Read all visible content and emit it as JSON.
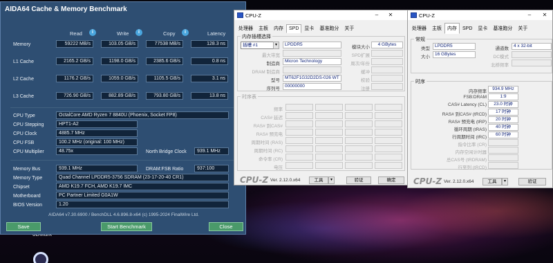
{
  "desktop": {
    "icon_label": "3DMark"
  },
  "aida": {
    "title": "AIDA64 Cache & Memory Benchmark",
    "col_read": "Read",
    "col_write": "Write",
    "col_copy": "Copy",
    "col_latency": "Latency",
    "rows": [
      {
        "label": "Memory",
        "read": "59222 MB/s",
        "write": "103.05 GB/s",
        "copy": "77538 MB/s",
        "latency": "128.3 ns"
      },
      {
        "label": "L1 Cache",
        "read": "2165.2 GB/s",
        "write": "1198.0 GB/s",
        "copy": "2385.6 GB/s",
        "latency": "0.8 ns"
      },
      {
        "label": "L2 Cache",
        "read": "1176.2 GB/s",
        "write": "1059.0 GB/s",
        "copy": "1105.5 GB/s",
        "latency": "3.1 ns"
      },
      {
        "label": "L3 Cache",
        "read": "726.90 GB/s",
        "write": "882.89 GB/s",
        "copy": "793.80 GB/s",
        "latency": "13.8 ns"
      }
    ],
    "cpu_type_label": "CPU Type",
    "cpu_type": "OctalCore AMD Ryzen 7 8840U  (Phoenix, Socket FP8)",
    "cpu_stepping_label": "CPU Stepping",
    "cpu_stepping": "HPT1-A2",
    "cpu_clock_label": "CPU Clock",
    "cpu_clock": "4885.7 MHz",
    "cpu_fsb_label": "CPU FSB",
    "cpu_fsb": "100.2 MHz  (original: 100 MHz)",
    "cpu_mult_label": "CPU Multiplier",
    "cpu_mult": "48.75x",
    "nb_clock_label": "North Bridge Clock",
    "nb_clock": "939.1 MHz",
    "mem_bus_label": "Memory Bus",
    "mem_bus": "939.1 MHz",
    "dram_ratio_label": "DRAM:FSB Ratio",
    "dram_ratio": "937:100",
    "mem_type_label": "Memory Type",
    "mem_type": "Quad Channel LPDDR5-3756 SDRAM  (23-17-20-40 CR1)",
    "chipset_label": "Chipset",
    "chipset": "AMD K19.7 FCH, AMD K19.7 IMC",
    "mobo_label": "Motherboard",
    "mobo": "PC Partner Limited G0A1W",
    "bios_label": "BIOS Version",
    "bios": "1.20",
    "footer": "AIDA64 v7.30.6900 / BenchDLL 4.6.896.8-x64  (c) 1995-2024 FinalWire Ltd.",
    "save": "Save",
    "start": "Start Benchmark",
    "close": "Close"
  },
  "cpuz1": {
    "title": "CPU-Z",
    "tabs": [
      "处理器",
      "主板",
      "内存",
      "SPD",
      "显卡",
      "基准跑分",
      "关于"
    ],
    "active_tab": "SPD",
    "group_slot": "内存插槽选择",
    "slot": "插槽 #1",
    "slot_type": "LPDDR5",
    "module_size_label": "模块大小",
    "module_size": "4 GBytes",
    "max_bw_label": "最大带宽",
    "spd_ext_label": "SPD扩展",
    "mfr_label": "制造商",
    "mfr": "Micron Technology",
    "week_year_label": "周次/年份",
    "dram_mfr_label": "DRAM 制造商",
    "rank_label": "缓冲",
    "part_label": "型号",
    "part": "MT62F1G32D2DS-026 WT",
    "check_label": "校验",
    "serial_label": "序列号",
    "serial": "00000000",
    "reg_label": "注册",
    "group_timing": "时序表",
    "timing_rows": [
      "频率",
      "CAS# 延迟",
      "RAS# 到CAS#",
      "RAS# 预充电",
      "周期时间 (RAS)",
      "周期时间 (RC)",
      "命令率 (CR)",
      "电压"
    ],
    "brand": "CPU-Z",
    "version": "Ver. 2.12.0.x64",
    "tools": "工具",
    "validate": "验证",
    "ok": "确定"
  },
  "cpuz2": {
    "title": "CPU-Z",
    "tabs": [
      "处理器",
      "主板",
      "内存",
      "SPD",
      "显卡",
      "基准跑分",
      "关于"
    ],
    "active_tab": "内存",
    "group_general": "常规",
    "type_label": "类型",
    "type": "LPDDR5",
    "channel_label": "通道数",
    "channel": "4 x 32-bit",
    "size_label": "大小",
    "size": "16 GBytes",
    "dc_label": "DC模式",
    "nb_freq_label": "北桥频率",
    "group_timings": "时序",
    "t_rows": [
      {
        "label": "内存频率",
        "value": "934.9 MHz"
      },
      {
        "label": "FSB:DRAM",
        "value": "1:9"
      },
      {
        "label": "CAS# Latency (CL)",
        "value": "23.0 时钟"
      },
      {
        "label": "RAS# 到CAS# (tRCD)",
        "value": "17 时钟"
      },
      {
        "label": "RAS# 预充电 (tRP)",
        "value": "20 时钟"
      },
      {
        "label": "循环周期 (tRAS)",
        "value": "40 时钟"
      },
      {
        "label": "行周期时间 (tRC)",
        "value": "60 时钟"
      },
      {
        "label": "指令比率 (CR)",
        "value": ""
      },
      {
        "label": "内存空闲计时器",
        "value": ""
      },
      {
        "label": "总CAS号 (tRDRAM)",
        "value": ""
      },
      {
        "label": "行至列 (tRCD)",
        "value": ""
      }
    ],
    "brand": "CPU-Z",
    "version": "Ver. 2.12.0.x64",
    "tools": "工具",
    "validate": "验证"
  }
}
